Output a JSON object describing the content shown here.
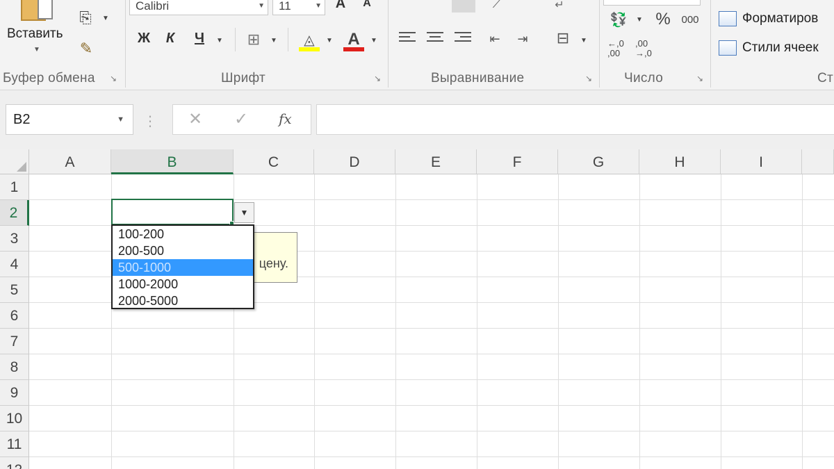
{
  "ribbon": {
    "clipboard": {
      "paste_label": "Вставить",
      "group_label": "Буфер обмена"
    },
    "font": {
      "font_name": "Calibri",
      "font_size": "11",
      "bold": "Ж",
      "italic": "К",
      "underline": "Ч",
      "grow": "A",
      "shrink": "A",
      "font_color_letter": "A",
      "group_label": "Шрифт"
    },
    "alignment": {
      "group_label": "Выравнивание"
    },
    "number": {
      "percent": "%",
      "thousands": "000",
      "inc_decimal": "←,0 ,00",
      "dec_decimal": ",00 →,0",
      "group_label": "Число"
    },
    "styles": {
      "conditional": "Форматиров",
      "cell_styles": "Стили ячеек",
      "group_label_partial": "Ст"
    }
  },
  "formula_bar": {
    "name_box": "B2",
    "cancel": "✕",
    "enter": "✓",
    "fx": "fx",
    "formula": ""
  },
  "grid": {
    "columns": [
      "A",
      "B",
      "C",
      "D",
      "E",
      "F",
      "G",
      "H",
      "I"
    ],
    "rows": [
      "1",
      "2",
      "3",
      "4",
      "5",
      "6",
      "7",
      "8",
      "9",
      "10",
      "11",
      "12"
    ],
    "selected_column": "B",
    "selected_row": "2",
    "active_cell": "B2",
    "active_cell_value": ""
  },
  "validation_dropdown": {
    "options": [
      "100-200",
      "200-500",
      "500-1000",
      "1000-2000",
      "2000-5000"
    ],
    "highlighted": "500-1000"
  },
  "input_message": {
    "visible_text": "цену."
  }
}
